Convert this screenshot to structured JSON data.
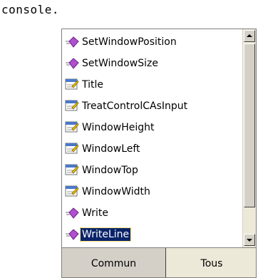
{
  "editor": {
    "code_line": "console."
  },
  "intellisense": {
    "items": [
      {
        "label": "SetWindowPosition",
        "icon": "method-icon"
      },
      {
        "label": "SetWindowSize",
        "icon": "method-icon"
      },
      {
        "label": "Title",
        "icon": "property-icon"
      },
      {
        "label": "TreatControlCAsInput",
        "icon": "property-icon"
      },
      {
        "label": "WindowHeight",
        "icon": "property-icon"
      },
      {
        "label": "WindowLeft",
        "icon": "property-icon"
      },
      {
        "label": "WindowTop",
        "icon": "property-icon"
      },
      {
        "label": "WindowWidth",
        "icon": "property-icon"
      },
      {
        "label": "Write",
        "icon": "method-icon"
      },
      {
        "label": "WriteLine",
        "icon": "method-icon",
        "selected": true
      }
    ],
    "tabs": [
      {
        "label": "Commun",
        "active": true
      },
      {
        "label": "Tous",
        "active": false
      }
    ]
  },
  "colors": {
    "selection": "#0a246a",
    "method": "#b04fd0",
    "property": "#e8c000",
    "tab_bar": "#d4d0c8"
  }
}
